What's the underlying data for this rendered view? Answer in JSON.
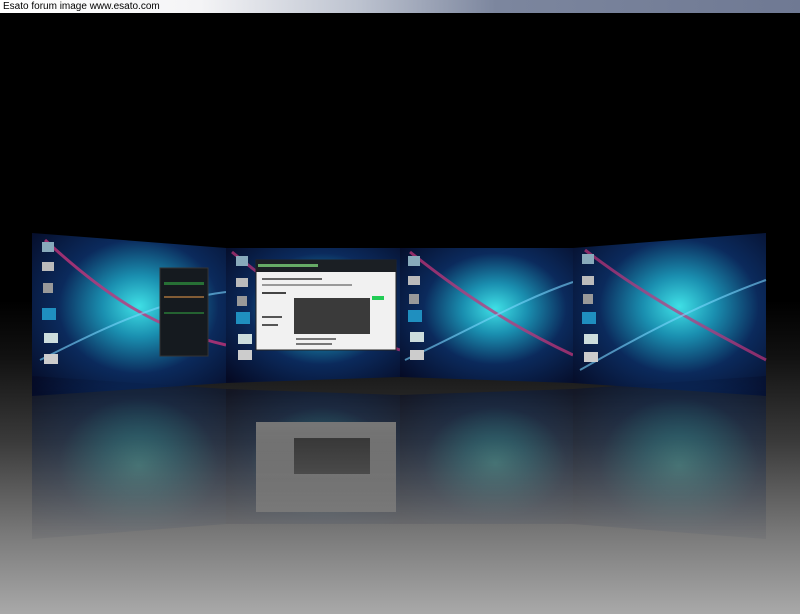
{
  "title_bar": {
    "text": "Esato forum image www.esato.com"
  },
  "desktops": [
    {
      "name": "desktop-1",
      "window": "dark-media-window"
    },
    {
      "name": "desktop-2",
      "window": "web-browser-window"
    },
    {
      "name": "desktop-3",
      "window": ""
    },
    {
      "name": "desktop-4",
      "window": ""
    }
  ],
  "colors": {
    "wallpaper_base": "#050a24",
    "wallpaper_glow": "#2ec7d6",
    "wallpaper_streak": "#c2357a",
    "floor_bottom": "#a9a9a9"
  },
  "icons": [
    "computer-icon",
    "folder-icon",
    "trash-icon",
    "media-icon",
    "monitor-icon",
    "drive-icon"
  ]
}
